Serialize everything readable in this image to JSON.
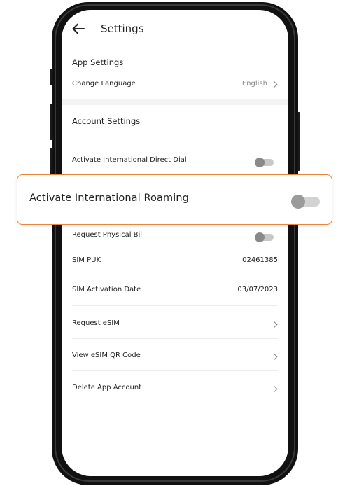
{
  "header": {
    "title": "Settings",
    "back_icon": "arrow-left-icon"
  },
  "app_settings": {
    "title": "App Settings",
    "change_language": {
      "label": "Change Language",
      "value": "English"
    }
  },
  "account_settings": {
    "title": "Account Settings",
    "international_direct_dial": {
      "label": "Activate International Direct Dial",
      "enabled": false
    },
    "international_roaming": {
      "label": "Activate International Roaming",
      "enabled": false
    },
    "physical_bill": {
      "label": "Request Physical Bill",
      "enabled": false
    },
    "sim_puk": {
      "label": "SIM PUK",
      "value": "02461385"
    },
    "sim_activation_date": {
      "label": "SIM Activation Date",
      "value": "03/07/2023"
    },
    "request_esim": {
      "label": "Request eSIM"
    },
    "view_esim_qr": {
      "label": "View eSIM QR Code"
    },
    "delete_account": {
      "label": "Delete App Account"
    }
  },
  "colors": {
    "highlight_border": "#e8853b",
    "toggle_off_track": "#c8c8c8",
    "toggle_off_knob": "#8a8a8a"
  }
}
